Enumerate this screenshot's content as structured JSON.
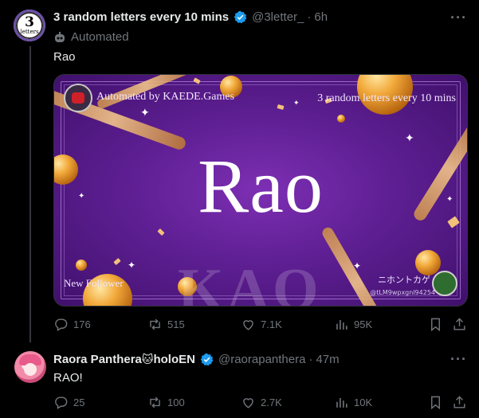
{
  "tweet1": {
    "display_name": "3 random letters every 10 mins",
    "handle": "@3letter_",
    "separator": "·",
    "time": "6h",
    "automated_label": "Automated",
    "text": "Rao",
    "avatar": {
      "big": "3",
      "small": "letters"
    },
    "media": {
      "automated_by": "Automated by KAEDE.Games",
      "caption": "3 random letters every 10 mins",
      "word": "Rao",
      "ghost": "KAO",
      "new_follower": "New Follower",
      "jp_name": "ニホントカゲ",
      "follower_id": "@tLM9wpxgnl94254"
    },
    "stats": {
      "replies": "176",
      "reposts": "515",
      "likes": "7.1K",
      "views": "95K"
    }
  },
  "tweet2": {
    "display_name": "Raora Panthera",
    "emoji": "🐱",
    "name_suffix": "holoEN",
    "handle": "@raorapanthera",
    "separator": "·",
    "time": "47m",
    "text": "RAO!",
    "stats": {
      "replies": "25",
      "reposts": "100",
      "likes": "2.7K",
      "views": "10K"
    }
  },
  "colors": {
    "accent": "#1d9bf0",
    "muted": "#71767b",
    "text": "#e7e9ea",
    "background": "#000000"
  }
}
